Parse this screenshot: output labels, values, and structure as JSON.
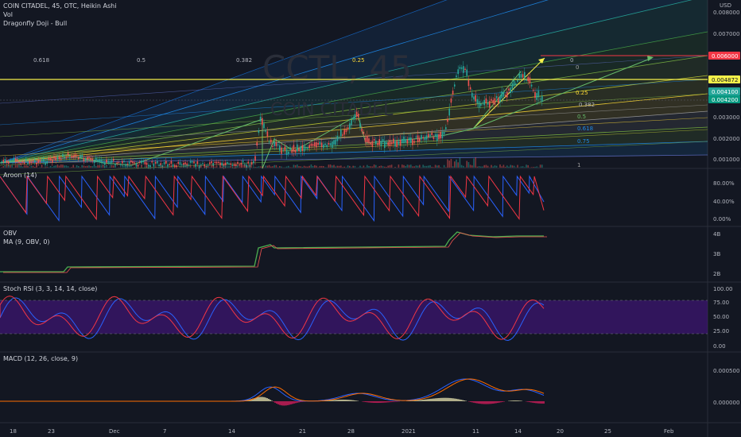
{
  "main_pane": {
    "symbol_line": "COIN CITADEL, 45, OTC, Heikin Ashi",
    "vol_label": "Vol",
    "pattern_label": "Dragonfly Doji - Bull",
    "watermark": "CCTL, 45",
    "watermark_sub": "COIN CITADEL",
    "currency": "USD",
    "price_ticks": [
      "0.008000",
      "0.007000",
      "0.003000",
      "0.002000",
      "0.001000"
    ],
    "price_tags": [
      {
        "text": "0.006000",
        "color": "#f23645",
        "bg": "#f23645"
      },
      {
        "text": "0.004872",
        "color": "#131722",
        "bg": "#f5f04a"
      },
      {
        "text": "0.004100",
        "color": "#ffffff",
        "bg": "#26a69a"
      },
      {
        "text": "0.004200",
        "color": "#ffffff",
        "bg": "#089981"
      }
    ],
    "fan_labels_top": [
      "0.618",
      "0.5",
      "0.382",
      "0.25",
      "0"
    ],
    "fan_labels_right": [
      "0",
      "0.25",
      "0.382",
      "0.5",
      "0.618",
      "0.75",
      "1"
    ]
  },
  "aroon_pane": {
    "title": "Aroon (14)",
    "ticks": [
      "80.00%",
      "40.00%",
      "0.00%"
    ]
  },
  "obv_pane": {
    "title": "OBV",
    "ma_title": "MA (9, OBV, 0)",
    "ticks": [
      "4B",
      "3B",
      "2B"
    ]
  },
  "stoch_pane": {
    "title": "Stoch RSI (3, 3, 14, 14, close)",
    "ticks": [
      "100.00",
      "75.00",
      "50.00",
      "25.00",
      "0.00"
    ]
  },
  "macd_pane": {
    "title": "MACD (12, 26, close, 9)",
    "ticks": [
      "0.000500",
      "0.000000"
    ]
  },
  "time_axis": {
    "labels": [
      "18",
      "23",
      "Dec",
      "7",
      "14",
      "21",
      "28",
      "2021",
      "11",
      "14",
      "20",
      "25",
      "Feb"
    ]
  },
  "colors": {
    "background": "#131722",
    "up": "#26a69a",
    "down": "#ef5350",
    "aroon_up": "#2962ff",
    "aroon_down": "#f23645",
    "obv": "#4caf50",
    "stoch_k": "#2962ff",
    "stoch_d": "#f23645",
    "stoch_band": "#7b1fa2",
    "macd": "#2962ff",
    "signal": "#ff6d00",
    "hist_pos": "#f5f1b8",
    "hist_neg": "#e91e63"
  },
  "chart_data": [
    {
      "type": "line",
      "panel": "price",
      "series": [
        {
          "name": "",
          "x": [
            "Nov 18",
            "Nov 23",
            "Dec 1",
            "Dec 7",
            "Dec 14",
            "Dec 17",
            "Dec 21",
            "Dec 28",
            "Dec 30",
            "2021",
            "Jan 6",
            "Jan 8",
            "Jan 11",
            "Jan 13",
            "Jan 14",
            "Jan 16"
          ],
          "values": [
            0.0007,
            0.0014,
            0.0008,
            0.0007,
            0.0008,
            0.0035,
            0.002,
            0.0025,
            0.0034,
            0.0022,
            0.0025,
            0.005,
            0.004,
            0.0044,
            0.0049,
            0.0042
          ]
        }
      ],
      "ylim": [
        0.0008,
        0.0085
      ],
      "annotations": [
        "0.618",
        "0.5",
        "0.382",
        "0.25",
        "0",
        "0.25",
        "0.382",
        "0.5",
        "0.618",
        "0.75",
        "1"
      ]
    },
    {
      "type": "line",
      "panel": "aroon",
      "title": "Aroon (14)",
      "ylim": [
        0,
        100
      ],
      "series": [
        {
          "name": "",
          "values": []
        },
        {
          "name": "",
          "values": []
        }
      ]
    },
    {
      "type": "line",
      "panel": "obv",
      "title": "OBV",
      "series": [
        {
          "name": "",
          "x": [
            "Nov 18",
            "Nov 23",
            "Nov 25",
            "Dec 14",
            "Dec 16",
            "Dec 17",
            "Dec 28",
            "Jan 6",
            "Jan 8",
            "Jan 11",
            "Jan 16"
          ],
          "values": [
            2.5,
            2.6,
            2.85,
            2.9,
            3.4,
            3.7,
            3.75,
            3.8,
            4.05,
            4.0,
            4.0
          ]
        }
      ]
    },
    {
      "type": "line",
      "panel": "stoch_rsi",
      "title": "Stoch RSI (3, 3, 14, 14, close)",
      "ylim": [
        0,
        100
      ],
      "bands": [
        20,
        80
      ]
    },
    {
      "type": "bar",
      "panel": "macd",
      "title": "MACD (12, 26, close, 9)",
      "categories": [
        "Dec 17",
        "Dec 21",
        "Dec 28",
        "2021",
        "Jan 8",
        "Jan 11",
        "Jan 14",
        "Jan 16"
      ],
      "values": [
        0.0002,
        5e-05,
        0.0001,
        -3e-05,
        0.0004,
        -8e-05,
        0.0002,
        -5e-05
      ]
    }
  ]
}
